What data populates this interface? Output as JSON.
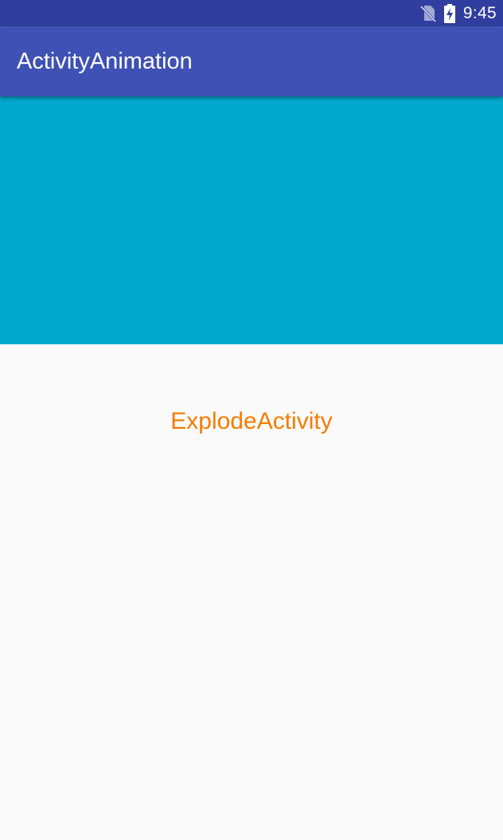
{
  "status_bar": {
    "time": "9:45",
    "icons": [
      "no-sim-icon",
      "battery-charging-icon"
    ]
  },
  "app_bar": {
    "title": "ActivityAnimation"
  },
  "content": {
    "label": "ExplodeActivity"
  },
  "colors": {
    "status_bar": "#303f9f",
    "primary": "#3f51b5",
    "hero_panel": "#00aacf",
    "label_text": "#f57c00",
    "background": "#fafafa"
  }
}
